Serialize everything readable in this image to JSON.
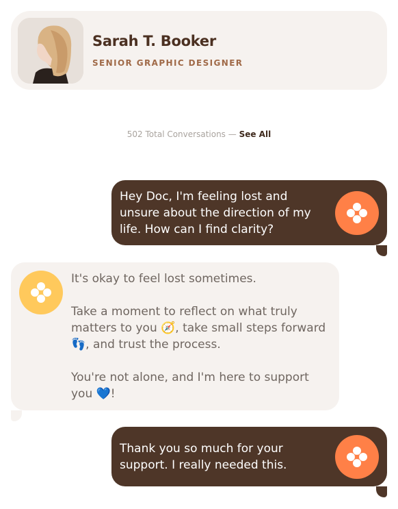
{
  "profile": {
    "name": "Sarah T. Booker",
    "role": "SENIOR GRAPHIC DESIGNER"
  },
  "conversations": {
    "count_text": "502 Total Conversations",
    "separator": " — ",
    "see_all": "See All"
  },
  "messages": [
    {
      "sender": "user",
      "text": "Hey Doc, I'm feeling lost and unsure about the direction of my life. How can I find clarity?"
    },
    {
      "sender": "assistant",
      "paragraphs": [
        "It's okay to feel lost sometimes.",
        "Take a moment to reflect on what truly matters to you 🧭, take small steps forward 👣, and trust the process.",
        "You're not alone, and I'm here to support you 💙!"
      ]
    },
    {
      "sender": "user",
      "text": "Thank you so much for your support. I really needed this."
    }
  ],
  "colors": {
    "user_bubble": "#4e3628",
    "assistant_bubble": "#f6f2ef",
    "user_icon": "#ff8047",
    "assistant_icon": "#ffc95c"
  },
  "icons": {
    "user": "flower-icon",
    "assistant": "flower-icon"
  }
}
